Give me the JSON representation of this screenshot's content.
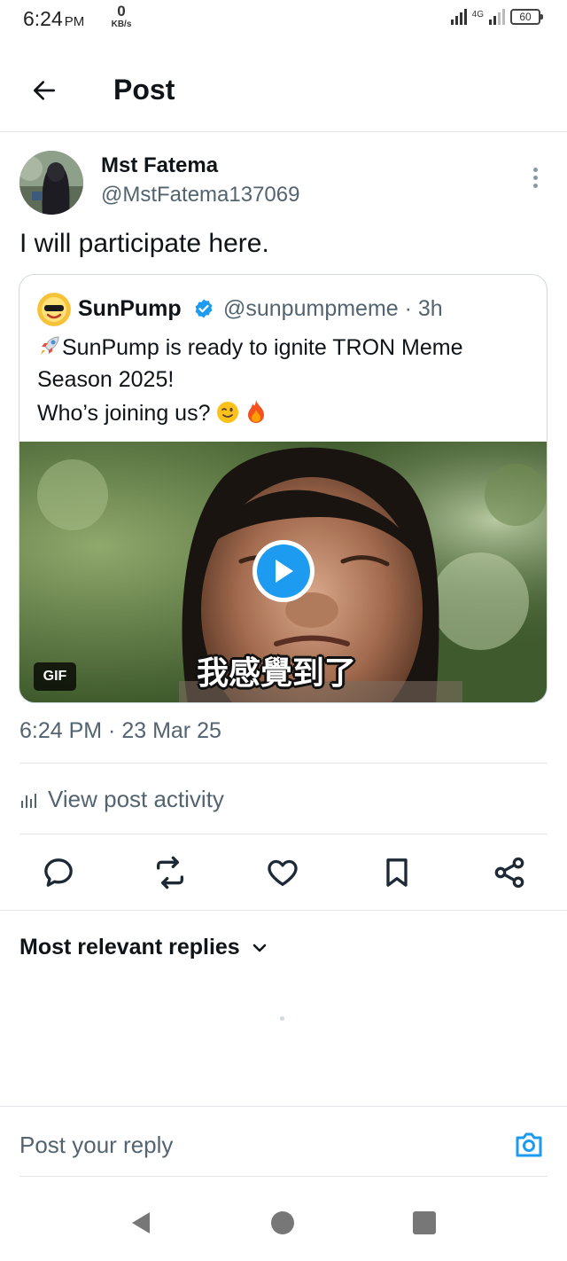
{
  "status_bar": {
    "time": "6:24",
    "ampm": "PM",
    "net_speed_value": "0",
    "net_speed_unit": "KB/s",
    "network_type": "4G",
    "battery": "60"
  },
  "header": {
    "back_icon": "arrow-left-icon",
    "title": "Post"
  },
  "post": {
    "author_name": "Mst Fatema",
    "author_handle": "@MstFatema137069",
    "text": "I will participate here.",
    "more_icon": "more-vertical-icon"
  },
  "quoted_post": {
    "author_name": "SunPump",
    "author_handle": "@sunpumpmeme · 3h",
    "line1": "SunPump is ready to ignite TRON Meme",
    "line2": "Season 2025!",
    "line3": "Who’s joining us?",
    "media": {
      "badge": "GIF",
      "subtitle": "我感覺到了",
      "play_icon": "play-icon"
    }
  },
  "timestamp": "6:24 PM · 23 Mar 25",
  "activity_label": "View post activity",
  "actions": [
    "reply-icon",
    "repost-icon",
    "like-icon",
    "bookmark-icon",
    "share-icon"
  ],
  "replies": {
    "sort_label": "Most relevant replies"
  },
  "reply_bar": {
    "placeholder": "Post your reply",
    "camera_icon": "camera-icon"
  },
  "colors": {
    "accent": "#1d9bf0",
    "text_primary": "#0f1419",
    "text_secondary": "#536471",
    "divider": "#e1e5e8"
  }
}
